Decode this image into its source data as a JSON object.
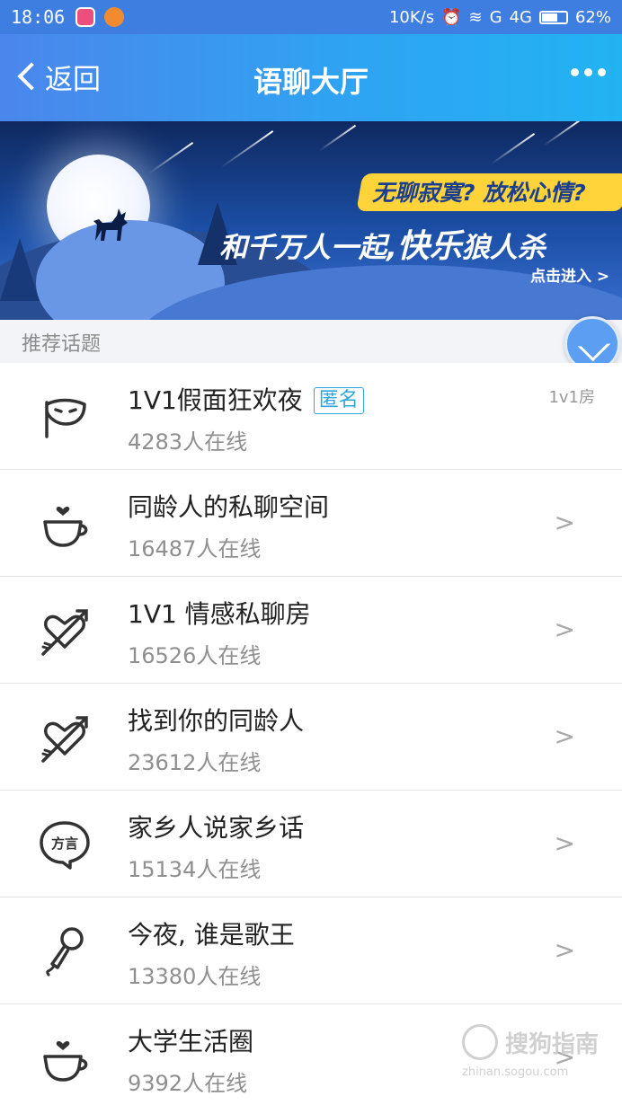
{
  "status_bar": {
    "time": "18:06",
    "net_speed": "10K/s",
    "signal_g": "G",
    "signal_4g": "4G",
    "battery": "62%"
  },
  "header": {
    "back_label": "返回",
    "title": "语聊大厅",
    "more_icon": "more-dots-icon"
  },
  "banner": {
    "question": "无聊寂寞? 放松心情?",
    "line_prefix": "和千万人一起,",
    "line_highlight": "快乐",
    "line_suffix": "狼人杀",
    "cta": "点击进入 >"
  },
  "section": {
    "title": "推荐话题"
  },
  "rooms": [
    {
      "name": "1V1假面狂欢夜",
      "tag": "匿名",
      "room_type": "1v1房",
      "count": "4283人在线",
      "icon": "mask-icon"
    },
    {
      "name": "同龄人的私聊空间",
      "count": "16487人在线",
      "icon": "coffee-heart-icon",
      "arrow": ">"
    },
    {
      "name": "1V1 情感私聊房",
      "count": "16526人在线",
      "icon": "heart-arrow-icon",
      "arrow": ">"
    },
    {
      "name": "找到你的同龄人",
      "count": "23612人在线",
      "icon": "heart-arrow-icon",
      "arrow": ">"
    },
    {
      "name": "家乡人说家乡话",
      "count": "15134人在线",
      "icon": "dialect-bubble-icon",
      "icon_text": "方言",
      "arrow": ">"
    },
    {
      "name": "今夜, 谁是歌王",
      "count": "13380人在线",
      "icon": "microphone-icon",
      "arrow": ">"
    },
    {
      "name": "大学生活圈",
      "count": "9392人在线",
      "icon": "coffee-heart-icon",
      "arrow": ">"
    }
  ],
  "watermark": {
    "name": "搜狗指南",
    "url": "zhinan.sogou.com"
  },
  "colors": {
    "accent": "#30a5e0",
    "header_start": "#4b86ec",
    "header_end": "#22b3f2"
  }
}
